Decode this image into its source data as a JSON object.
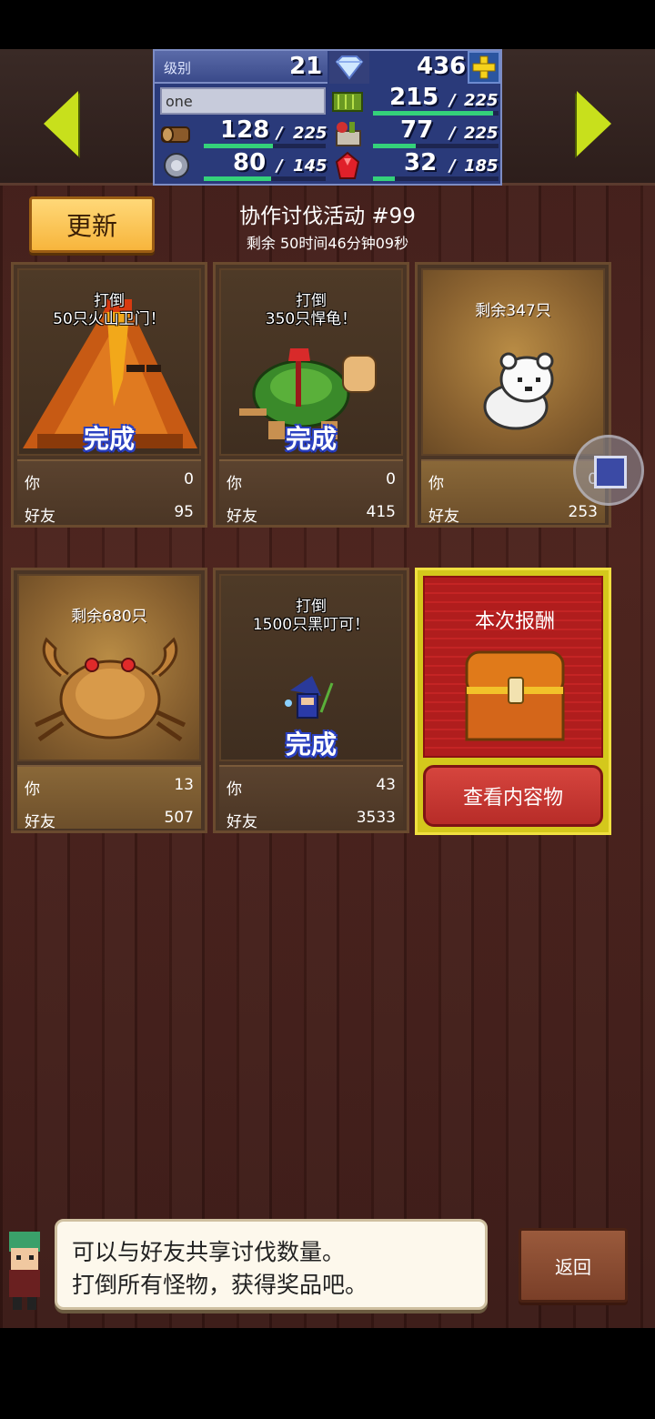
{
  "header": {
    "level_label": "级别",
    "level_value": "21",
    "gems": "436",
    "player_name": "one",
    "grass": {
      "value": "215",
      "max": "225",
      "fill": 0.956
    },
    "wood": {
      "value": "128",
      "max": "225",
      "fill": 0.569
    },
    "food": {
      "value": "77",
      "max": "225",
      "fill": 0.342
    },
    "stone": {
      "value": "80",
      "max": "145",
      "fill": 0.552
    },
    "ruby": {
      "value": "32",
      "max": "185",
      "fill": 0.173
    },
    "separator": "/"
  },
  "event": {
    "refresh_label": "更新",
    "title": "协作讨伐活动 #99",
    "time_left": "剩余 50时间46分钟09秒"
  },
  "labels": {
    "you": "你",
    "friends": "好友"
  },
  "cards": [
    {
      "goal_line1": "打倒",
      "goal_line2": "50只火山卫门！",
      "status": "完成",
      "you": "0",
      "friends": "95",
      "monster": "volcano"
    },
    {
      "goal_line1": "打倒",
      "goal_line2": "350只悍龟！",
      "status": "完成",
      "you": "0",
      "friends": "415",
      "monster": "turtle"
    },
    {
      "remaining": "剩余347只",
      "you": "0",
      "friends": "253",
      "monster": "white-bear"
    },
    {
      "remaining": "剩余680只",
      "you": "13",
      "friends": "507",
      "monster": "crab"
    },
    {
      "goal_line1": "打倒",
      "goal_line2": "1500只黑叮可！",
      "status": "完成",
      "you": "43",
      "friends": "3533",
      "monster": "wizard"
    }
  ],
  "reward": {
    "title": "本次报酬",
    "button": "查看内容物"
  },
  "dialog": {
    "line1": "可以与好友共享讨伐数量。",
    "line2": "打倒所有怪物，获得奖品吧。"
  },
  "back_label": "返回",
  "colors": {
    "accent_yellow": "#c8e01c",
    "stat_panel": "#2a3a7a",
    "bar_fill": "#34d27a",
    "complete_outline": "#2a40c0"
  }
}
